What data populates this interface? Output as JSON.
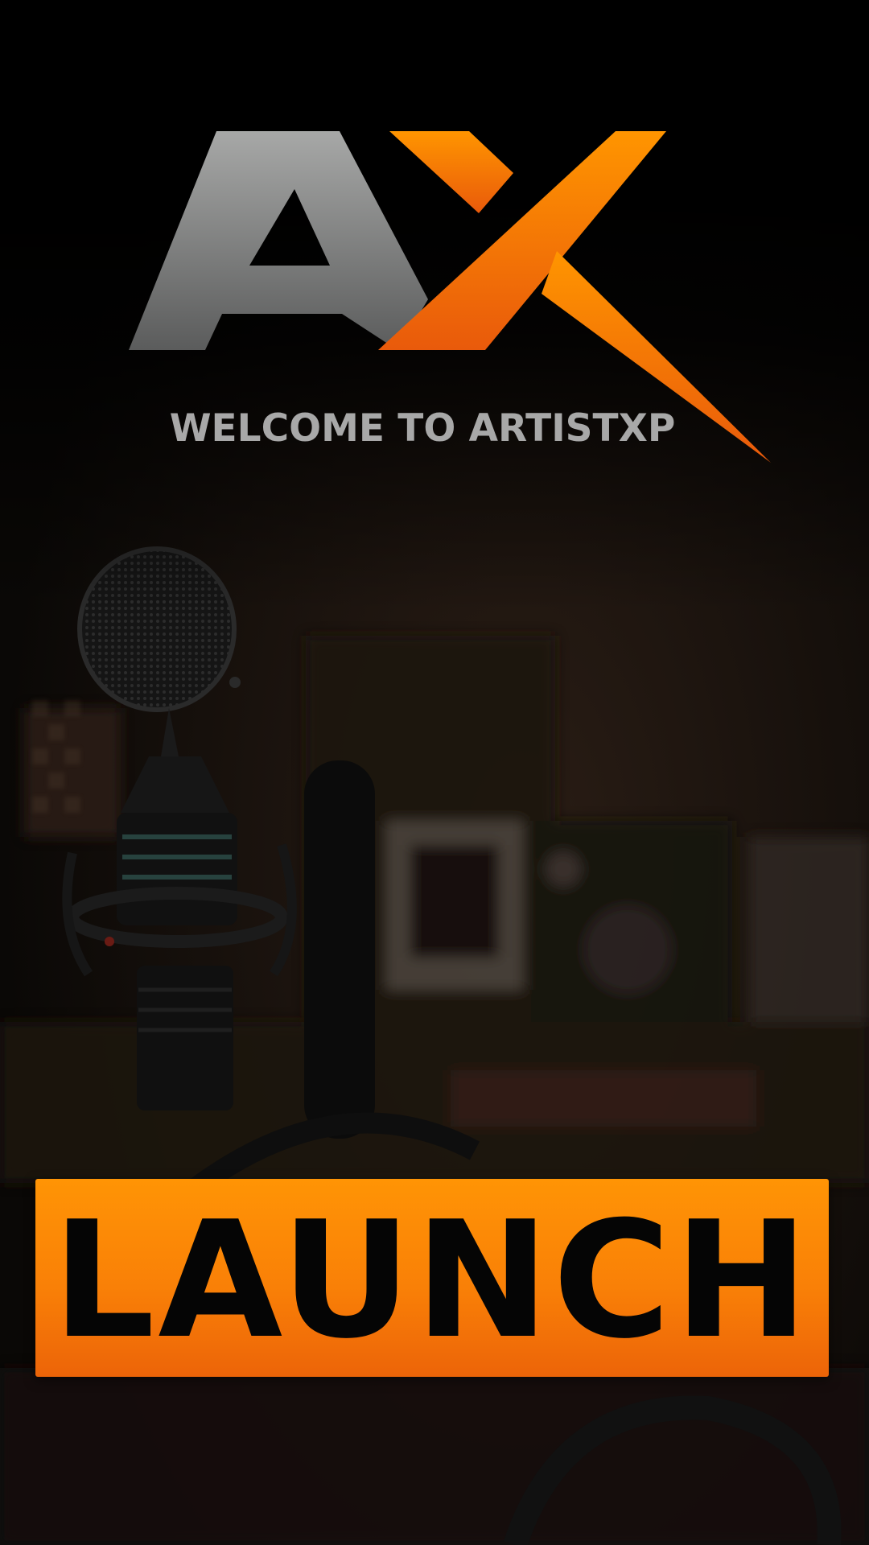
{
  "welcome_text": "WELCOME TO ARTISTXP",
  "launch_label": "LAUNCH",
  "logo": {
    "icon": "ax-logo-icon",
    "letters": "AX"
  },
  "background": {
    "icon": "studio-microphone-photo"
  },
  "colors": {
    "accent_orange": "#ff9405",
    "accent_orange_dark": "#ec6408",
    "logo_gray": "#a6a7a6",
    "text_gray": "#a8a8a8"
  }
}
